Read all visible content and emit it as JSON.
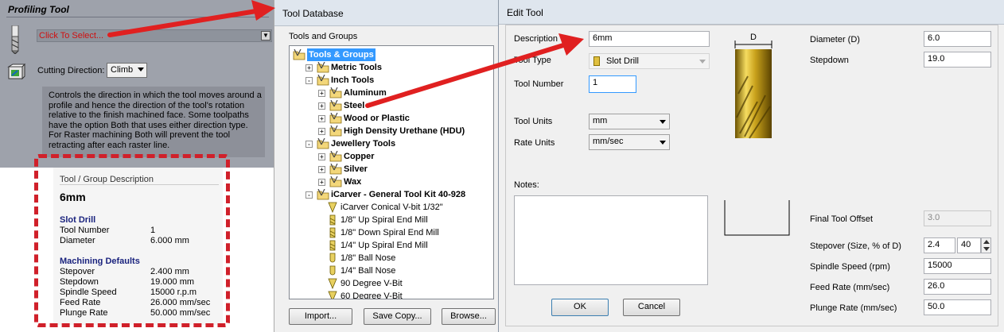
{
  "profiling": {
    "title": "Profiling Tool",
    "tool_select_text": "Click To Select...",
    "cutting_direction_label": "Cutting Direction:",
    "cutting_direction_value": "Climb",
    "help_lines": [
      "Controls the direction in which the tool moves around a",
      "profile and hence the direction of the tool's rotation",
      "relative to the finish machined face. Some toolpaths",
      "have the option Both that uses either direction type.",
      "For Raster machining Both will prevent the tool",
      "retracting after each raster line."
    ]
  },
  "description_box": {
    "title": "Tool / Group Description",
    "name": "6mm",
    "tool_type": "Slot Drill",
    "tool_rows": [
      {
        "key": "Tool Number",
        "value": "1"
      },
      {
        "key": "Diameter",
        "value": "6.000 mm"
      }
    ],
    "machining_heading": "Machining Defaults",
    "machining_rows": [
      {
        "key": "Stepover",
        "value": "2.400 mm"
      },
      {
        "key": "Stepdown",
        "value": "19.000 mm"
      },
      {
        "key": "Spindle Speed",
        "value": "15000 r.p.m"
      },
      {
        "key": "Feed Rate",
        "value": "26.000 mm/sec"
      },
      {
        "key": "Plunge Rate",
        "value": "50.000 mm/sec"
      }
    ]
  },
  "tool_database": {
    "title": "Tool Database",
    "tree_label": "Tools and Groups",
    "tree": [
      {
        "label": "Tools & Groups",
        "level": 0,
        "expander": "",
        "icon": "folder-tool-icon",
        "bold": true,
        "selected": true
      },
      {
        "label": "Metric Tools",
        "level": 1,
        "expander": "+",
        "icon": "folder-tool-icon",
        "bold": true
      },
      {
        "label": "Inch Tools",
        "level": 1,
        "expander": "-",
        "icon": "folder-tool-icon",
        "bold": true
      },
      {
        "label": "Aluminum",
        "level": 2,
        "expander": "+",
        "icon": "folder-tool-icon",
        "bold": true
      },
      {
        "label": "Steel",
        "level": 2,
        "expander": "+",
        "icon": "folder-tool-icon",
        "bold": true
      },
      {
        "label": "Wood or Plastic",
        "level": 2,
        "expander": "+",
        "icon": "folder-tool-icon",
        "bold": true
      },
      {
        "label": "High Density Urethane (HDU)",
        "level": 2,
        "expander": "+",
        "icon": "folder-tool-icon",
        "bold": true
      },
      {
        "label": "Jewellery Tools",
        "level": 1,
        "expander": "-",
        "icon": "folder-tool-icon",
        "bold": true
      },
      {
        "label": "Copper",
        "level": 2,
        "expander": "+",
        "icon": "folder-tool-icon",
        "bold": true
      },
      {
        "label": "Silver",
        "level": 2,
        "expander": "+",
        "icon": "folder-tool-icon",
        "bold": true
      },
      {
        "label": "Wax",
        "level": 2,
        "expander": "+",
        "icon": "folder-tool-icon",
        "bold": true
      },
      {
        "label": "iCarver - General Tool Kit 40-928",
        "level": 1,
        "expander": "-",
        "icon": "folder-tool-icon",
        "bold": true
      },
      {
        "label": "iCarver Conical V-bit 1/32\"",
        "level": 2,
        "expander": "",
        "icon": "conical-bit-icon",
        "bold": false
      },
      {
        "label": "1/8\" Up Spiral End Mill",
        "level": 2,
        "expander": "",
        "icon": "end-mill-icon",
        "bold": false
      },
      {
        "label": "1/8\" Down Spiral End Mill",
        "level": 2,
        "expander": "",
        "icon": "end-mill-icon",
        "bold": false
      },
      {
        "label": "1/4\" Up Spiral End Mill",
        "level": 2,
        "expander": "",
        "icon": "end-mill-icon",
        "bold": false
      },
      {
        "label": "1/8\" Ball Nose",
        "level": 2,
        "expander": "",
        "icon": "ball-nose-icon",
        "bold": false
      },
      {
        "label": "1/4\" Ball Nose",
        "level": 2,
        "expander": "",
        "icon": "ball-nose-icon",
        "bold": false
      },
      {
        "label": "90 Degree V-Bit",
        "level": 2,
        "expander": "",
        "icon": "v-bit-icon",
        "bold": false
      },
      {
        "label": "60 Degree V-Bit",
        "level": 2,
        "expander": "",
        "icon": "v-bit-icon",
        "bold": false
      }
    ],
    "import_label": "Import...",
    "save_copy_label": "Save Copy...",
    "browse_label": "Browse..."
  },
  "edit_tool": {
    "title": "Edit Tool",
    "description_label": "Description",
    "description_value": "6mm",
    "tool_type_label": "Tool Type",
    "tool_type_value": "Slot Drill",
    "tool_number_label": "Tool Number",
    "tool_number_value": "1",
    "tool_units_label": "Tool Units",
    "tool_units_value": "mm",
    "rate_units_label": "Rate Units",
    "rate_units_value": "mm/sec",
    "notes_label": "Notes:",
    "diagram_label": "D",
    "diameter_label": "Diameter (D)",
    "diameter_value": "6.0",
    "stepdown_label": "Stepdown",
    "stepdown_value": "19.0",
    "final_offset_label": "Final Tool Offset",
    "final_offset_value": "3.0",
    "stepover_label": "Stepover (Size, % of D)",
    "stepover_size": "2.4",
    "stepover_percent": "40",
    "spindle_label": "Spindle Speed (rpm)",
    "spindle_value": "15000",
    "feed_label": "Feed Rate (mm/sec)",
    "feed_value": "26.0",
    "plunge_label": "Plunge Rate (mm/sec)",
    "plunge_value": "50.0",
    "ok_label": "OK",
    "cancel_label": "Cancel"
  },
  "colors": {
    "annotation_red": "#e02020",
    "selection_blue": "#3399ff",
    "heading_navy": "#1a237e",
    "panel_gray": "#9ea2ab"
  }
}
